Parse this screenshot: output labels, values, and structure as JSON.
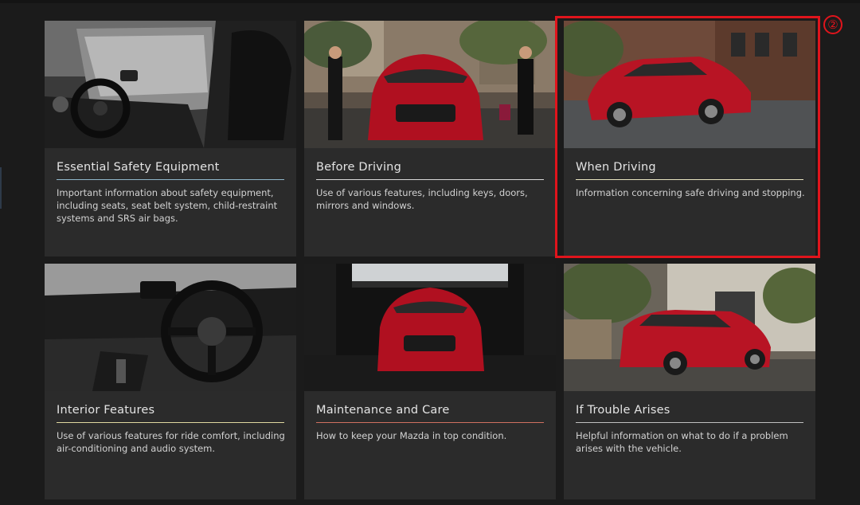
{
  "cards": [
    {
      "title": "Essential Safety Equipment",
      "description": "Important information about safety equipment, including seats, seat belt system, child-restraint systems and SRS air bags.",
      "image": "car-interior-seats-image",
      "accent": "#8fb6c9"
    },
    {
      "title": "Before Driving",
      "description": "Use of various features, including keys, doors, mirrors and windows.",
      "image": "car-front-street-people-image",
      "accent": "#d9d9d9"
    },
    {
      "title": "When Driving",
      "description": "Information concerning safe driving and stopping.",
      "image": "car-driving-street-image",
      "accent": "#e8e4c0"
    },
    {
      "title": "Interior Features",
      "description": "Use of various features for ride comfort, including air-conditioning and audio system.",
      "image": "dashboard-steering-wheel-image",
      "accent": "#e0d8a0"
    },
    {
      "title": "Maintenance and Care",
      "description": "How to keep your Mazda in top condition.",
      "image": "car-garage-front-image",
      "accent": "#d07060"
    },
    {
      "title": "If Trouble Arises",
      "description": "Helpful information on what to do if a problem arises with the vehicle.",
      "image": "car-parked-rear-image",
      "accent": "#c0c0c0"
    }
  ],
  "annotation": {
    "label": "②",
    "color": "#e0141c"
  }
}
